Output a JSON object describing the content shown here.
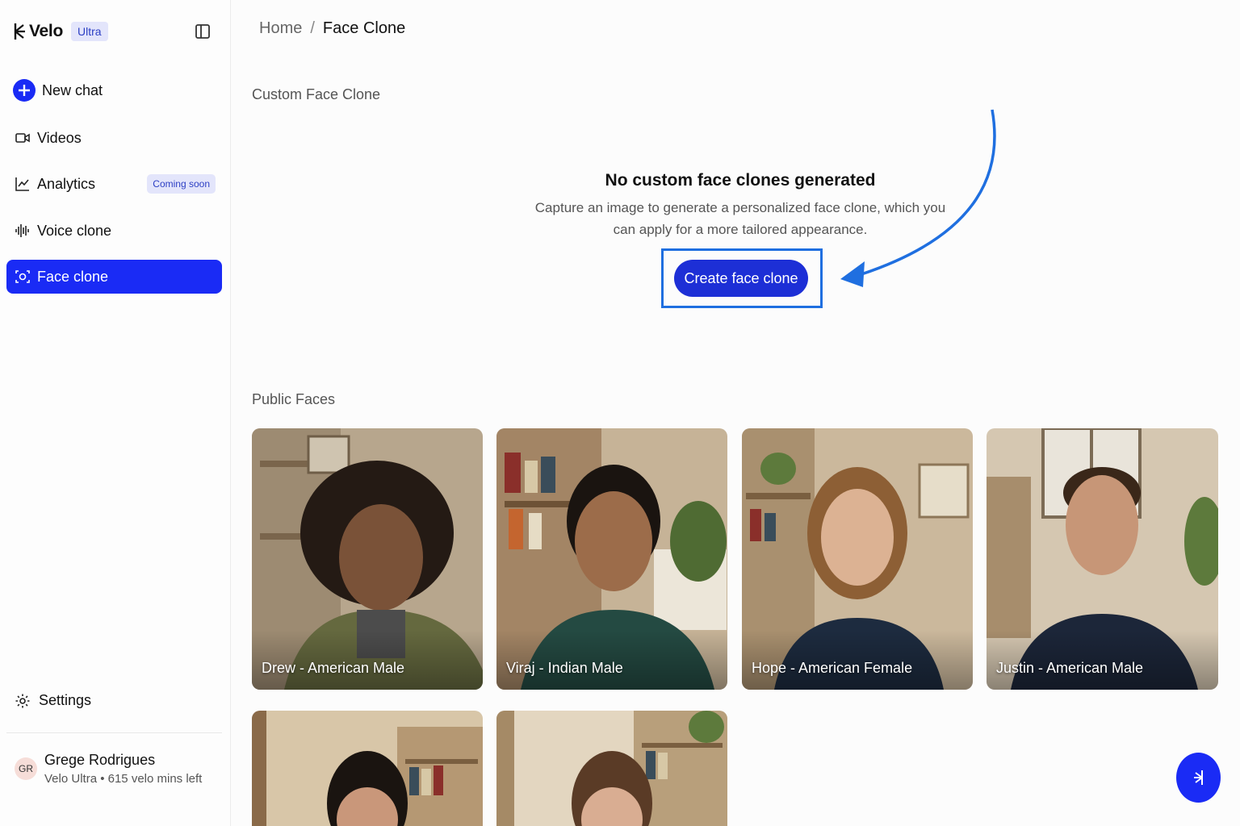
{
  "brand": {
    "name": "Velo",
    "badge": "Ultra"
  },
  "sidebar": {
    "items": [
      {
        "label": "New chat",
        "icon": "plus-circle-icon"
      },
      {
        "label": "Videos",
        "icon": "video-icon"
      },
      {
        "label": "Analytics",
        "icon": "chart-line-icon",
        "badge": "Coming soon"
      },
      {
        "label": "Voice clone",
        "icon": "waveform-icon"
      },
      {
        "label": "Face clone",
        "icon": "face-scan-icon",
        "active": true
      }
    ],
    "settings_label": "Settings",
    "user": {
      "initials": "GR",
      "name": "Grege Rodrigues",
      "meta": "Velo Ultra • 615 velo mins left"
    }
  },
  "breadcrumb": {
    "home": "Home",
    "separator": "/",
    "current": "Face Clone"
  },
  "custom": {
    "section_label": "Custom Face Clone",
    "empty_title": "No custom face clones generated",
    "empty_desc": "Capture an image to generate a personalized face clone, which you can apply for a more tailored appearance.",
    "cta_label": "Create face clone"
  },
  "public": {
    "section_label": "Public Faces",
    "faces": [
      {
        "label": "Drew - American Male"
      },
      {
        "label": "Viraj - Indian Male"
      },
      {
        "label": "Hope - American Female"
      },
      {
        "label": "Justin - American Male"
      },
      {
        "label": ""
      },
      {
        "label": ""
      }
    ]
  },
  "colors": {
    "accent": "#1a2bf5",
    "cta": "#1d2fd6",
    "highlight": "#1f6fe0"
  }
}
